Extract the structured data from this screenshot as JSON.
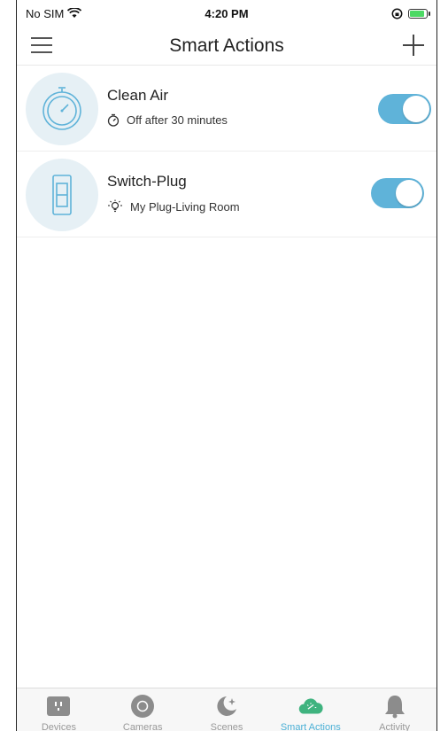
{
  "status_bar": {
    "carrier": "No SIM",
    "time": "4:20 PM"
  },
  "header": {
    "title": "Smart Actions"
  },
  "actions": [
    {
      "name": "Clean Air",
      "detail": "Off after 30 minutes",
      "detail_icon": "timer-icon",
      "avatar_icon": "stopwatch-icon",
      "enabled": true
    },
    {
      "name": "Switch-Plug",
      "detail": "My Plug-Living Room",
      "detail_icon": "bulb-icon",
      "avatar_icon": "switch-icon",
      "enabled": true
    }
  ],
  "tabs": [
    {
      "label": "Devices",
      "icon": "plug-icon",
      "active": false
    },
    {
      "label": "Cameras",
      "icon": "camera-icon",
      "active": false
    },
    {
      "label": "Scenes",
      "icon": "moon-icon",
      "active": false
    },
    {
      "label": "Smart Actions",
      "icon": "smart-actions-icon",
      "active": true
    },
    {
      "label": "Activity",
      "icon": "bell-icon",
      "active": false
    }
  ],
  "colors": {
    "accent": "#5fb3d9",
    "avatar_bg": "#e6f0f5",
    "active_tab": "#4bb0d6"
  }
}
